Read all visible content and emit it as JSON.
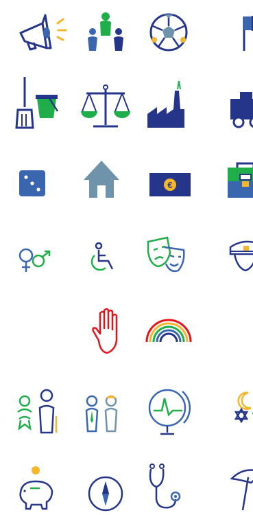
{
  "colors": {
    "navy": "#25368a",
    "blue": "#3a66b0",
    "green": "#1fae4a",
    "slate": "#6f93aa",
    "yellow": "#f6b62b",
    "red": "#e3141b",
    "black": "#222222"
  },
  "icons": [
    [
      "megaphone-icon",
      "people-group-icon",
      "football-icon",
      "flag-icon"
    ],
    [
      "broom-bucket-icon",
      "scales-icon",
      "factory-icon",
      "train-icon"
    ],
    [
      "dice-icon",
      "house-icon",
      "euro-banknote-icon",
      "briefcase-icon"
    ],
    [
      "gender-symbols-icon",
      "wheelchair-icon",
      "theatre-masks-icon",
      "police-cap-icon"
    ],
    [
      "stop-hand-icon",
      "rainbow-icon"
    ],
    [
      "child-elder-icon",
      "worker-people-icon",
      "globe-chart-icon",
      "religion-symbols-icon"
    ],
    [
      "piggy-bank-icon",
      "compass-icon",
      "stethoscope-icon",
      "beach-umbrella-icon"
    ]
  ]
}
